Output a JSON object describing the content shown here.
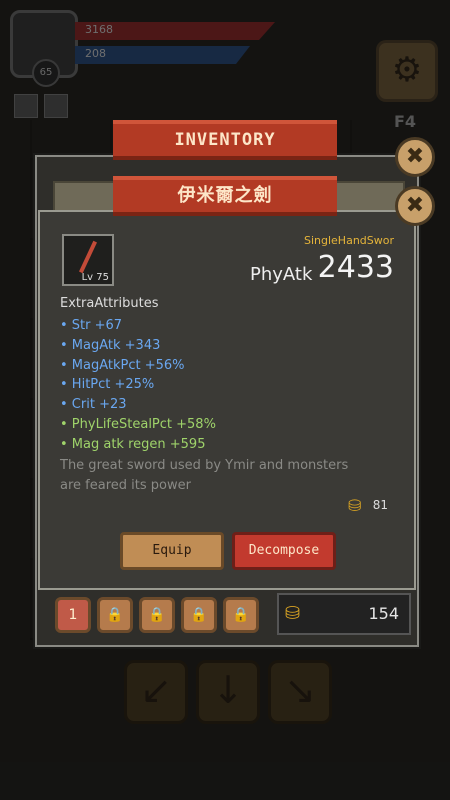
{
  "hud": {
    "hp_value": "3168",
    "mp_value": "208",
    "player_level": "65",
    "floor": "F4"
  },
  "inventory": {
    "title": "INVENTORY",
    "slot_first_label": "1",
    "gold": "154"
  },
  "item": {
    "name": "伊米爾之劍",
    "level": "Lv 75",
    "type": "SingleHandSwor",
    "main_stat_name": "PhyAtk",
    "main_stat_value": "2433",
    "extra_title": "ExtraAttributes",
    "attributes": [
      {
        "text": "• Str +67",
        "color": "blue"
      },
      {
        "text": "• MagAtk +343",
        "color": "blue"
      },
      {
        "text": "• MagAtkPct +56%",
        "color": "blue"
      },
      {
        "text": "• HitPct +25%",
        "color": "blue"
      },
      {
        "text": "• Crit +23",
        "color": "blue"
      },
      {
        "text": "• PhyLifeStealPct +58%",
        "color": "green"
      },
      {
        "text": "• Mag atk regen +595",
        "color": "green"
      }
    ],
    "description": "The great sword used by Ymir and monsters are feared its power",
    "price": "81"
  },
  "buttons": {
    "equip": "Equip",
    "decompose": "Decompose"
  },
  "icons": {
    "close": "close-icon",
    "gear": "gear-icon",
    "coin": "coin-icon",
    "lock": "lock-icon",
    "arrow_down_left": "arrow-down-left-icon",
    "arrow_down": "arrow-down-icon",
    "arrow_down_right": "arrow-down-right-icon"
  },
  "colors": {
    "ribbon": "#b23a24",
    "item_type": "#e5b43a",
    "attr_blue": "#6aa7f0",
    "attr_green": "#9fd36a",
    "decompose": "#c23a2e",
    "equip": "#c08d55"
  }
}
